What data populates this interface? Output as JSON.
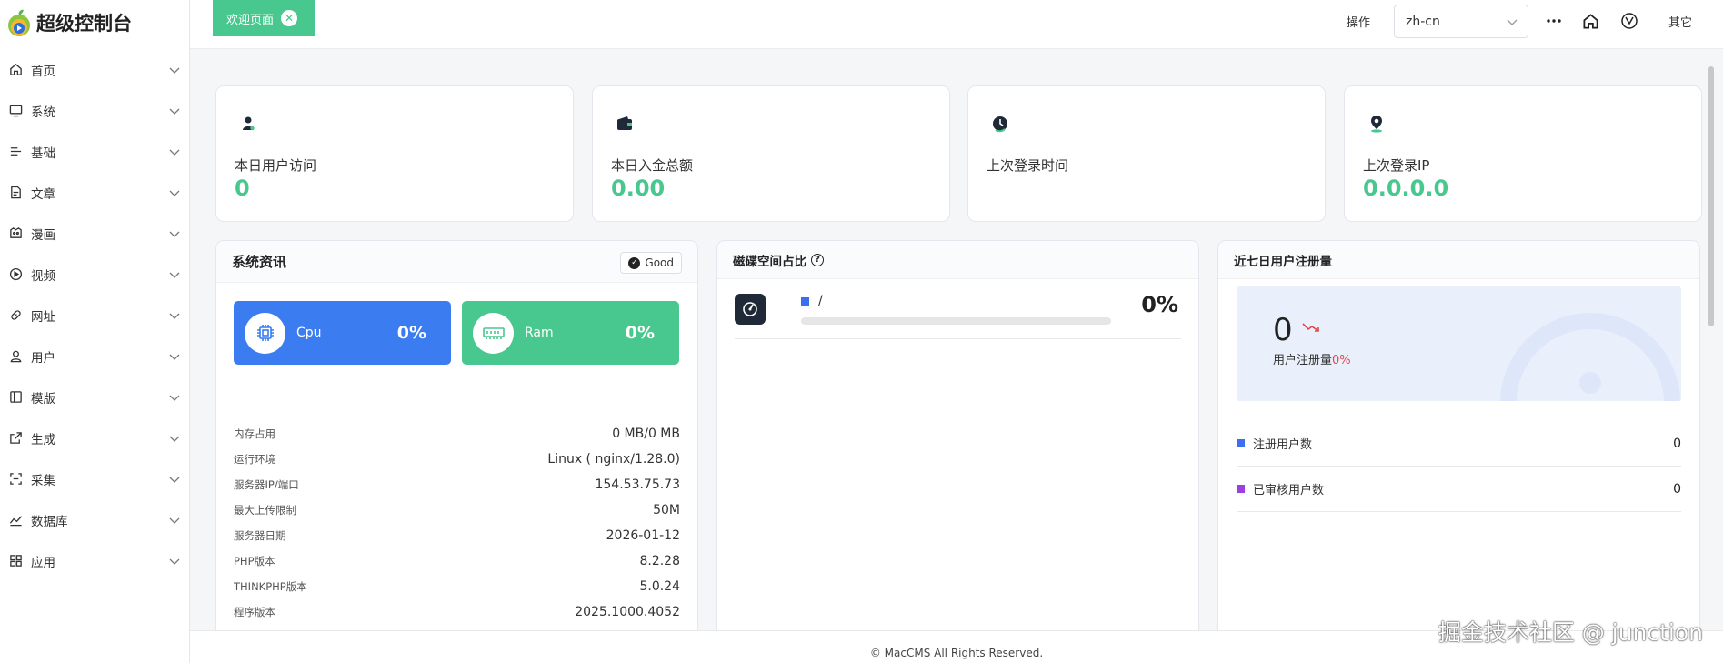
{
  "app": {
    "title": "超级控制台"
  },
  "sidebar": {
    "items": [
      {
        "label": "首页",
        "icon": "home-icon"
      },
      {
        "label": "系统",
        "icon": "monitor-icon"
      },
      {
        "label": "基础",
        "icon": "list-icon"
      },
      {
        "label": "文章",
        "icon": "article-icon"
      },
      {
        "label": "漫画",
        "icon": "comic-icon"
      },
      {
        "label": "视频",
        "icon": "play-icon"
      },
      {
        "label": "网址",
        "icon": "link-icon"
      },
      {
        "label": "用户",
        "icon": "user-icon"
      },
      {
        "label": "模版",
        "icon": "template-icon"
      },
      {
        "label": "生成",
        "icon": "generate-icon"
      },
      {
        "label": "采集",
        "icon": "collect-icon"
      },
      {
        "label": "数据库",
        "icon": "chart-line-icon"
      },
      {
        "label": "应用",
        "icon": "apps-icon"
      }
    ]
  },
  "header": {
    "tab_label": "欢迎页面",
    "ops_label": "操作",
    "lang_value": "zh-cn",
    "other_label": "其它"
  },
  "stats": [
    {
      "label": "本日用户访问",
      "value": "0",
      "icon": "user-icon"
    },
    {
      "label": "本日入金总额",
      "value": "0.00",
      "icon": "wallet-icon"
    },
    {
      "label": "上次登录时间",
      "value": "",
      "icon": "clock-icon"
    },
    {
      "label": "上次登录IP",
      "value": "0.0.0.0",
      "icon": "location-icon"
    }
  ],
  "system": {
    "title": "系统资讯",
    "status": "Good",
    "cpu": {
      "name": "Cpu",
      "pct": "0%",
      "color": "#3b7cf0"
    },
    "ram": {
      "name": "Ram",
      "pct": "0%",
      "color": "#48c78e"
    },
    "rows": [
      {
        "k": "内存占用",
        "v": "0 MB/0 MB"
      },
      {
        "k": "运行环境",
        "v": "Linux ( nginx/1.28.0)"
      },
      {
        "k": "服务器IP/端口",
        "v": "154.53.75.73"
      },
      {
        "k": "最大上传限制",
        "v": "50M"
      },
      {
        "k": "服务器日期",
        "v": "2026-01-12"
      },
      {
        "k": "PHP版本",
        "v": "8.2.28"
      },
      {
        "k": "THINKPHP版本",
        "v": "5.0.24"
      },
      {
        "k": "程序版本",
        "v": "2025.1000.4052"
      }
    ]
  },
  "disk": {
    "title": "磁碟空间占比",
    "path": "/",
    "pct": "0%",
    "fill_fraction": 0
  },
  "register": {
    "title": "近七日用户注册量",
    "count": "0",
    "label": "用户注册量",
    "pct": "0%",
    "rows": [
      {
        "label": "注册用户数",
        "value": "0",
        "color": "#3b6ff0"
      },
      {
        "label": "已审核用户数",
        "value": "0",
        "color": "#9b3fe0"
      }
    ]
  },
  "footer": {
    "text": "© MacCMS All Rights Reserved."
  },
  "watermark": "掘金技术社区 @ junction"
}
